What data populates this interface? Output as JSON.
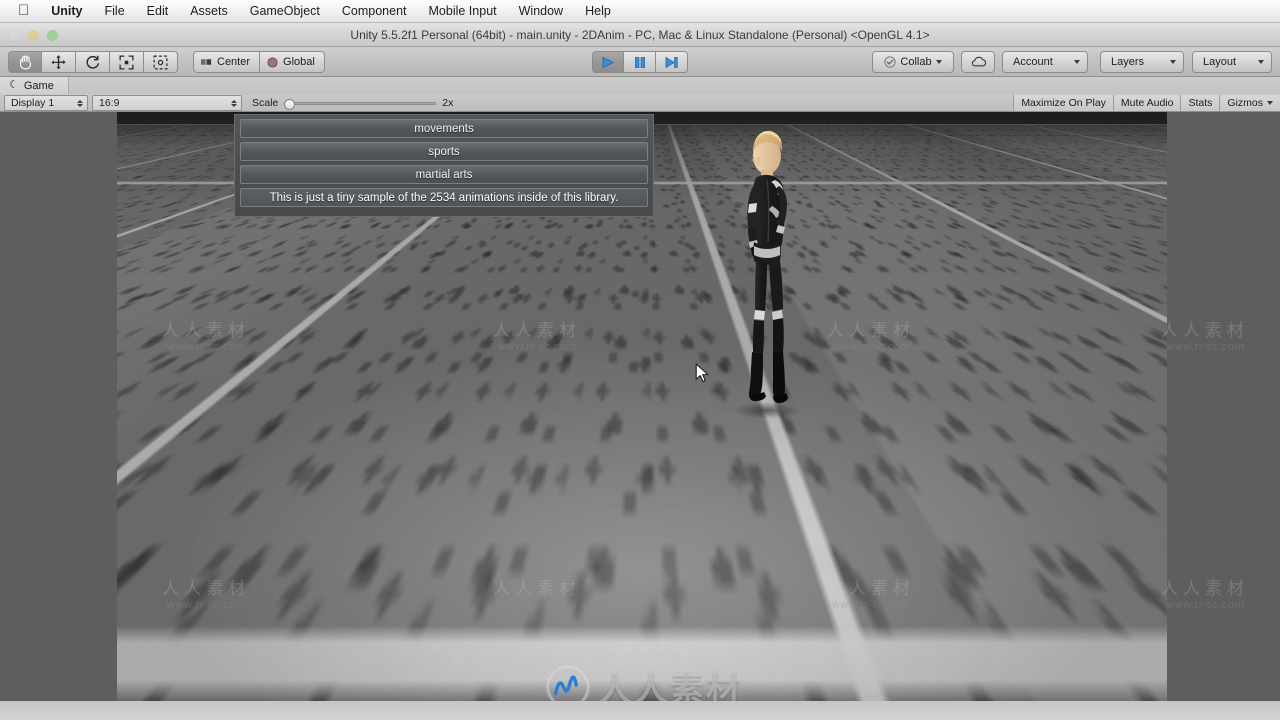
{
  "menubar": {
    "apple_icon": "apple-logo",
    "items": [
      {
        "label": "Unity",
        "bold": true
      },
      {
        "label": "File",
        "bold": false
      },
      {
        "label": "Edit",
        "bold": false
      },
      {
        "label": "Assets",
        "bold": false
      },
      {
        "label": "GameObject",
        "bold": false
      },
      {
        "label": "Component",
        "bold": false
      },
      {
        "label": "Mobile Input",
        "bold": false
      },
      {
        "label": "Window",
        "bold": false
      },
      {
        "label": "Help",
        "bold": false
      }
    ]
  },
  "window": {
    "title": "Unity 5.5.2f1 Personal (64bit) - main.unity - 2DAnim - PC, Mac & Linux Standalone (Personal) <OpenGL 4.1>"
  },
  "toolbar": {
    "tools": [
      {
        "name": "hand-tool",
        "selected": true
      },
      {
        "name": "move-tool",
        "selected": false
      },
      {
        "name": "rotate-tool",
        "selected": false
      },
      {
        "name": "scale-tool",
        "selected": false
      },
      {
        "name": "rect-tool",
        "selected": false
      }
    ],
    "pivot_label": "Center",
    "handle_label": "Global",
    "play_label": "Play",
    "pause_label": "Pause",
    "step_label": "Step",
    "collab_label": "Collab",
    "cloud_label": "Services",
    "account_label": "Account",
    "layers_label": "Layers",
    "layout_label": "Layout"
  },
  "gameview": {
    "tab_label": "Game",
    "display": "Display 1",
    "aspect": "16:9",
    "scale_label": "Scale",
    "scale_value": "2x",
    "maximize_on_play": "Maximize On Play",
    "mute_audio": "Mute Audio",
    "stats": "Stats",
    "gizmos": "Gizmos"
  },
  "game_ui": {
    "buttons": [
      {
        "label": "movements"
      },
      {
        "label": "sports"
      },
      {
        "label": "martial arts"
      }
    ],
    "info_label": "This is just a tiny sample of the 2534 animations inside of this library."
  },
  "watermarks": {
    "cn_text": "人人素材",
    "url_text": "www.rr-sc.com",
    "big_url": "WWW.rr-sc.c",
    "logo_name": "rrsc-logo"
  },
  "colors": {
    "toolbar_bg": "#c2c2c2",
    "gameview_bg": "#5e5e5e",
    "play_accent": "#3a8fd8",
    "ui_panel": "#4c4f51"
  }
}
